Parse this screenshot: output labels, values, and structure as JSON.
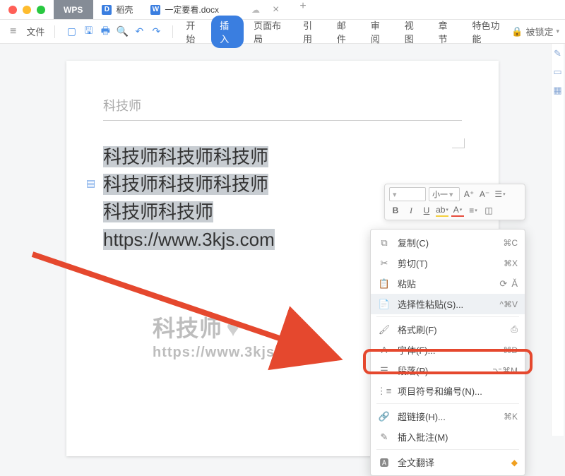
{
  "titlebar": {
    "wps": "WPS",
    "tab1": "稻壳",
    "tab2": "一定要看.docx"
  },
  "toolbar": {
    "file": "文件",
    "tabs": [
      "开始",
      "插入",
      "页面布局",
      "引用",
      "邮件",
      "审阅",
      "视图",
      "章节",
      "特色功能"
    ],
    "active_index": 1,
    "locked": "被锁定"
  },
  "doc": {
    "header": "科技师",
    "lines": [
      "科技师科技师科技师",
      "科技师科技师科技师",
      "科技师科技师",
      "https://www.3kjs.com"
    ]
  },
  "watermark": {
    "line1": "科技师",
    "line2": "https://www.3kjs.com"
  },
  "mini": {
    "font_size": "小一",
    "aplus": "A⁺",
    "aminus": "A⁻"
  },
  "context_menu": {
    "items": [
      {
        "icon": "copy",
        "label": "复制(C)",
        "shortcut": "⌘C"
      },
      {
        "icon": "cut",
        "label": "剪切(T)",
        "shortcut": "⌘X"
      },
      {
        "icon": "paste",
        "label": "粘贴",
        "side": true
      },
      {
        "icon": "paste-special",
        "label": "选择性粘贴(S)...",
        "shortcut": "^⌘V",
        "hover": true
      },
      {
        "sep": true
      },
      {
        "icon": "brush",
        "label": "格式刷(F)",
        "side_icon": true
      },
      {
        "icon": "font",
        "label": "字体(F)...",
        "shortcut": "⌘D"
      },
      {
        "icon": "paragraph",
        "label": "段落(P)...",
        "shortcut": "⌥⌘M",
        "highlight": true
      },
      {
        "icon": "bullets",
        "label": "项目符号和编号(N)..."
      },
      {
        "sep": true
      },
      {
        "icon": "link",
        "label": "超链接(H)...",
        "shortcut": "⌘K"
      },
      {
        "icon": "comment",
        "label": "插入批注(M)"
      },
      {
        "sep": true
      },
      {
        "icon": "translate",
        "label": "全文翻译",
        "side_icon": true
      }
    ]
  }
}
